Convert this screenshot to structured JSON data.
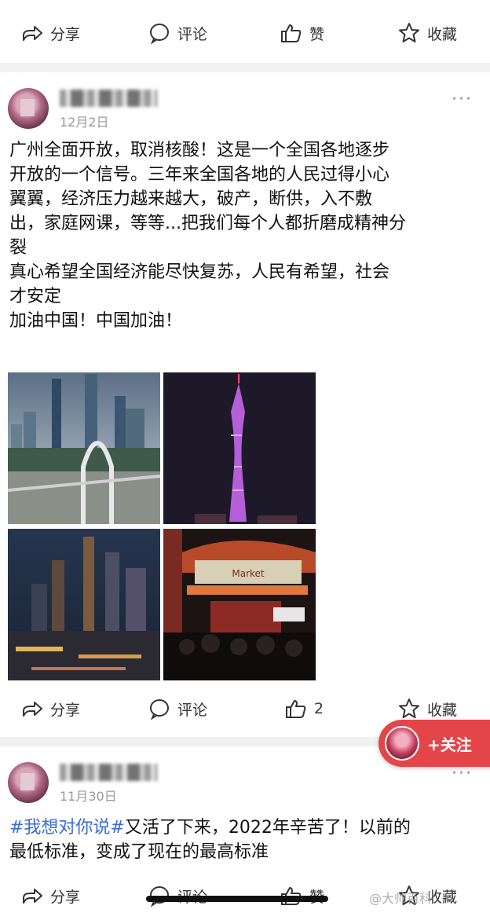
{
  "actions": {
    "share": "分享",
    "comment": "评论",
    "like": "赞",
    "like_count": "2",
    "collect": "收藏"
  },
  "posts": [
    {
      "date": "12月2日",
      "more": "···",
      "lines": [
        "广州全面开放，取消核酸！这是一个全国各地逐步",
        "开放的一个信号。三年来全国各地的人民过得小心",
        "翼翼，经济压力越来越大，破产，断供，入不敷",
        "出，家庭网课，等等...把我们每个人都折磨成精神分",
        "裂",
        "真心希望全国经济能尽快复苏，人民有希望，社会",
        "才安定",
        "加油中国！中国加油！"
      ],
      "photos": [
        "guangzhou-skyline-bridge",
        "canton-tower-night",
        "city-night-skyline",
        "night-market-gate"
      ],
      "gate_sign": "Market"
    },
    {
      "date": "11月30日",
      "more": "···",
      "hashtag": "#我想对你说#",
      "line1_rest": "又活了下来，2022年辛苦了！以前的",
      "line2": "最低标准，变成了现在的最高标准"
    }
  ],
  "follow": {
    "label": "+关注"
  },
  "watermark": "@大帅百科"
}
